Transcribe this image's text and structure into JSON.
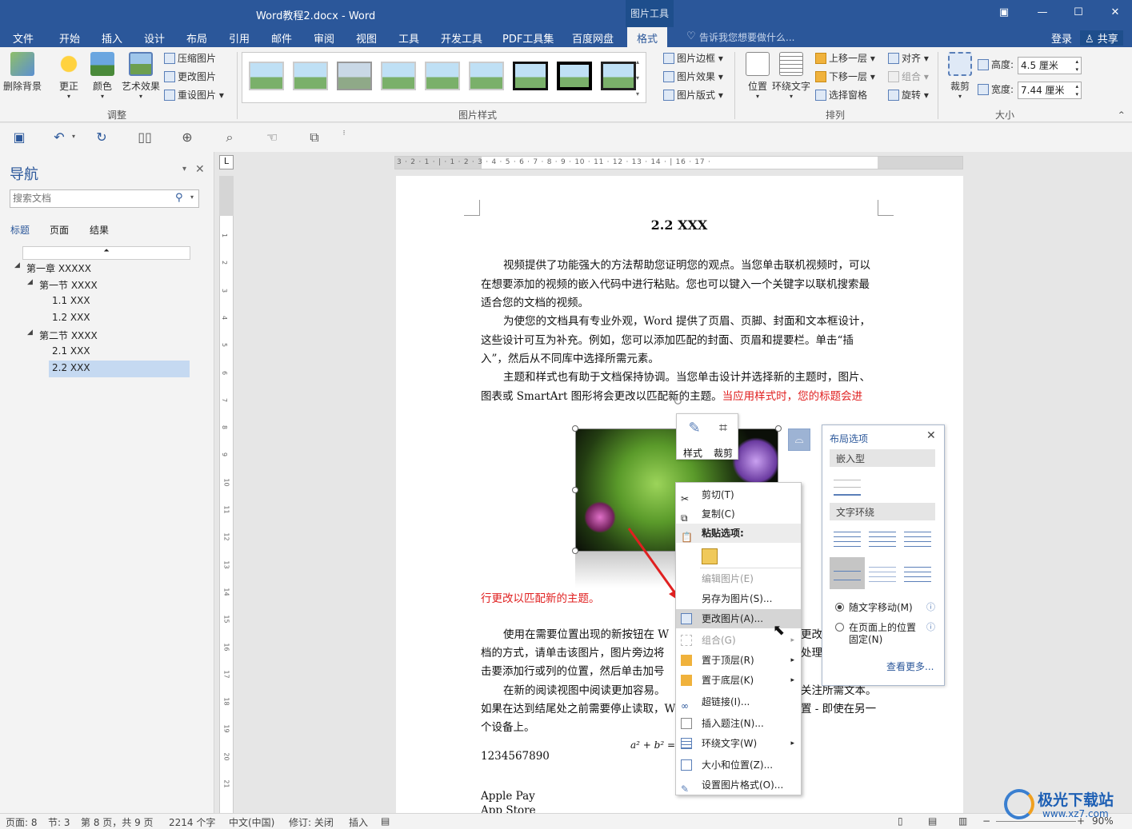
{
  "titlebar": {
    "title": "Word教程2.docx - Word",
    "context_tab": "图片工具",
    "restore_icon": "ribbon-display-icon"
  },
  "tabs": [
    "文件",
    "开始",
    "插入",
    "设计",
    "布局",
    "引用",
    "邮件",
    "审阅",
    "视图",
    "工具",
    "开发工具",
    "PDF工具集",
    "百度网盘",
    "格式"
  ],
  "active_tab": "格式",
  "tell_me": "告诉我您想要做什么...",
  "account": {
    "login": "登录",
    "share": "共享"
  },
  "ribbon": {
    "adjust": {
      "remove_bg": "删除背景",
      "correct": "更正",
      "color": "颜色",
      "artistic": "艺术效果",
      "compress": "压缩图片",
      "change": "更改图片",
      "reset": "重设图片",
      "group": "调整"
    },
    "styles": {
      "border": "图片边框",
      "effects": "图片效果",
      "layout": "图片版式",
      "group": "图片样式"
    },
    "arrange": {
      "position": "位置",
      "wrap": "环绕文字",
      "forward": "上移一层",
      "backward": "下移一层",
      "pane": "选择窗格",
      "align": "对齐",
      "group_btn": "组合",
      "rotate": "旋转",
      "group": "排列"
    },
    "size": {
      "crop": "裁剪",
      "height_label": "高度:",
      "height": "4.5 厘米",
      "width_label": "宽度:",
      "width": "7.44 厘米",
      "group": "大小"
    }
  },
  "nav": {
    "title": "导航",
    "search_placeholder": "搜索文档",
    "tabs": [
      "标题",
      "页面",
      "结果"
    ],
    "tree": [
      {
        "label": "第一章 XXXXX",
        "level": 0
      },
      {
        "label": "第一节 XXXX",
        "level": 1
      },
      {
        "label": "1.1 XXX",
        "level": 2
      },
      {
        "label": "1.2 XXX",
        "level": 2
      },
      {
        "label": "第二节 XXXX",
        "level": 1
      },
      {
        "label": "2.1 XXX",
        "level": 2
      },
      {
        "label": "2.2 XXX",
        "level": 2,
        "selected": true
      }
    ]
  },
  "ruler": {
    "h": "3 · 2 · 1 · | · 1 · 2 · 3 · 4 · 5 · 6 · 7 · 8 · 9 · 10 · 11 · 12 · 13 · 14 · | 16 · 17 ·",
    "v": [
      "1",
      "2",
      "3",
      "4",
      "5",
      "6",
      "7",
      "8",
      "9",
      "10",
      "11",
      "12",
      "13",
      "14",
      "15",
      "16",
      "17",
      "18",
      "19",
      "20",
      "21"
    ]
  },
  "doc": {
    "heading": "2.2 XXX",
    "p1": "视频提供了功能强大的方法帮助您证明您的观点。当您单击联机视频时，可以在想要添加的视频的嵌入代码中进行粘贴。您也可以键入一个关键字以联机搜索最适合您的文档的视频。",
    "p2": "为使您的文档具有专业外观，Word 提供了页眉、页脚、封面和文本框设计，这些设计可互为补充。例如，您可以添加匹配的封面、页眉和提要栏。单击“插入”，然后从不同库中选择所需元素。",
    "p3a": "主题和样式也有助于文档保持协调。当您单击设计并选择新的主题时，图片、图表或 SmartArt 图形将会更改以匹配新的主题。",
    "p3b": "当应用样式时，您的标题会进",
    "p3c": "行更改以匹配新的主题。",
    "p4": "使用在需要位置出现的新按钮在 W",
    "p4b": "档的方式，请单击该图片，图片旁边将",
    "p4c": "击要添加行或列的位置，然后单击加号",
    "p4d": "更改",
    "p4e": "处理",
    "p5": "在新的阅读视图中阅读更加容易。",
    "p5b": "关注所需文本。",
    "p5c": "如果在达到结尾处之前需要停止读取，W",
    "p5d": "置 - 即使在另一",
    "p5e": "个设备上。",
    "formula": "a² + b² =",
    "num": "1234567890",
    "l1": "Apple Pay",
    "l2": "App Store"
  },
  "mini_toolbar": {
    "style": "样式",
    "crop": "裁剪"
  },
  "context_menu": [
    {
      "label": "剪切(T)",
      "icon": "scissors-icon",
      "state": "normal"
    },
    {
      "label": "复制(C)",
      "icon": "copy-icon",
      "state": "normal"
    },
    {
      "label": "粘贴选项:",
      "icon": "paste-icon",
      "state": "header"
    },
    {
      "label": "",
      "icon": "paste-picture-icon",
      "state": "pasteopt"
    },
    {
      "label": "编辑图片(E)",
      "icon": "",
      "state": "disabled"
    },
    {
      "label": "另存为图片(S)...",
      "icon": "",
      "state": "normal"
    },
    {
      "label": "更改图片(A)...",
      "icon": "change-picture-icon",
      "state": "highlight"
    },
    {
      "label": "组合(G)",
      "icon": "group-icon",
      "state": "disabled-sub"
    },
    {
      "label": "置于顶层(R)",
      "icon": "bring-front-icon",
      "state": "sub"
    },
    {
      "label": "置于底层(K)",
      "icon": "send-back-icon",
      "state": "sub"
    },
    {
      "label": "超链接(I)...",
      "icon": "link-icon",
      "state": "normal"
    },
    {
      "label": "插入题注(N)...",
      "icon": "caption-icon",
      "state": "normal"
    },
    {
      "label": "环绕文字(W)",
      "icon": "wrap-icon",
      "state": "sub"
    },
    {
      "label": "大小和位置(Z)...",
      "icon": "size-icon",
      "state": "normal"
    },
    {
      "label": "设置图片格式(O)...",
      "icon": "format-icon",
      "state": "normal"
    }
  ],
  "layout_options": {
    "title": "布局选项",
    "inline": "嵌入型",
    "wrap": "文字环绕",
    "move": "随文字移动(M)",
    "fix1": "在页面上的位置",
    "fix2": "固定(N)",
    "more": "查看更多..."
  },
  "status": {
    "page": "页面: 8",
    "section": "节: 3",
    "pages": "第 8 页，共 9 页",
    "words": "2214 个字",
    "lang": "中文(中国)",
    "track": "修订: 关闭",
    "mode": "插入",
    "zoom": "90%"
  },
  "watermark": {
    "title": "极光下载站",
    "url": "www.xz7.com"
  },
  "colors": {
    "accent": "#2b579a",
    "red_text": "#e02020",
    "arrow": "#e02020"
  }
}
